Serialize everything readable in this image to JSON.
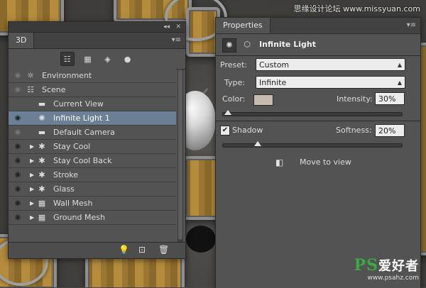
{
  "watermark": {
    "top": "思缘设计论坛 www.missyuan.com",
    "logo_ps": "PS",
    "logo_text": "爱好者",
    "url": "www.psahz.com"
  },
  "panel3d": {
    "tab_label": "3D",
    "collapse_glyph": "◂◂",
    "close_glyph": "✕",
    "menu_glyph": "▾≡",
    "filters": [
      {
        "name": "scene-filter-icon",
        "glyph": "☷",
        "active": true
      },
      {
        "name": "mesh-filter-icon",
        "glyph": "▦",
        "active": false
      },
      {
        "name": "material-filter-icon",
        "glyph": "◈",
        "active": false
      },
      {
        "name": "light-filter-icon",
        "glyph": "●",
        "active": false
      }
    ],
    "layers": [
      {
        "label": "Environment",
        "icon": "☼",
        "icon_name": "environment-icon",
        "indent": 0,
        "expand": false,
        "eye": "dim",
        "selected": false
      },
      {
        "label": "Scene",
        "icon": "☷",
        "icon_name": "scene-icon",
        "indent": 0,
        "expand": false,
        "eye": "dim",
        "selected": false
      },
      {
        "label": "Current View",
        "icon": "▬",
        "icon_name": "camera-icon",
        "indent": 1,
        "expand": false,
        "eye": "none",
        "selected": false
      },
      {
        "label": "Infinite Light 1",
        "icon": "✺",
        "icon_name": "infinite-light-icon",
        "indent": 1,
        "expand": false,
        "eye": "on",
        "selected": true
      },
      {
        "label": "Default Camera",
        "icon": "▬",
        "icon_name": "camera-icon",
        "indent": 1,
        "expand": false,
        "eye": "dim",
        "selected": false
      },
      {
        "label": "Stay  Cool",
        "icon": "✱",
        "icon_name": "mesh-icon",
        "indent": 1,
        "expand": true,
        "eye": "on",
        "selected": false
      },
      {
        "label": "Stay  Cool Back",
        "icon": "✱",
        "icon_name": "mesh-icon",
        "indent": 1,
        "expand": true,
        "eye": "on",
        "selected": false
      },
      {
        "label": "Stroke",
        "icon": "✱",
        "icon_name": "mesh-icon",
        "indent": 1,
        "expand": true,
        "eye": "on",
        "selected": false
      },
      {
        "label": "Glass",
        "icon": "✱",
        "icon_name": "mesh-icon",
        "indent": 1,
        "expand": true,
        "eye": "on",
        "selected": false
      },
      {
        "label": "Wall Mesh",
        "icon": "▦",
        "icon_name": "mesh-icon",
        "indent": 1,
        "expand": true,
        "eye": "on",
        "selected": false
      },
      {
        "label": "Ground Mesh",
        "icon": "▦",
        "icon_name": "mesh-icon",
        "indent": 1,
        "expand": true,
        "eye": "on",
        "selected": false
      }
    ],
    "bottom_icons": {
      "light": "💡",
      "render": "⊡",
      "trash": "🗑"
    }
  },
  "properties": {
    "tab_label": "Properties",
    "menu_glyph": "▾≡",
    "collapse_glyph": "◂◂",
    "title": "Infinite Light",
    "light_mode_glyph": "✺",
    "coords_mode_glyph": "⬡",
    "preset": {
      "label": "Preset:",
      "value": "Custom"
    },
    "type": {
      "label": "Type:",
      "value": "Infinite"
    },
    "color": {
      "label": "Color:",
      "swatch": "#c7bbb0"
    },
    "intensity": {
      "label": "Intensity:",
      "value": "30%",
      "fraction": 0.03
    },
    "shadow": {
      "label": "Shadow",
      "checked": true,
      "check_glyph": "✔"
    },
    "softness": {
      "label": "Softness:",
      "value": "20%",
      "fraction": 0.2
    },
    "move_to_view": {
      "label": "Move to view",
      "icon": "◧"
    }
  },
  "colors": {
    "selected_row": "#6b7f95",
    "panel_bg": "#535353"
  }
}
